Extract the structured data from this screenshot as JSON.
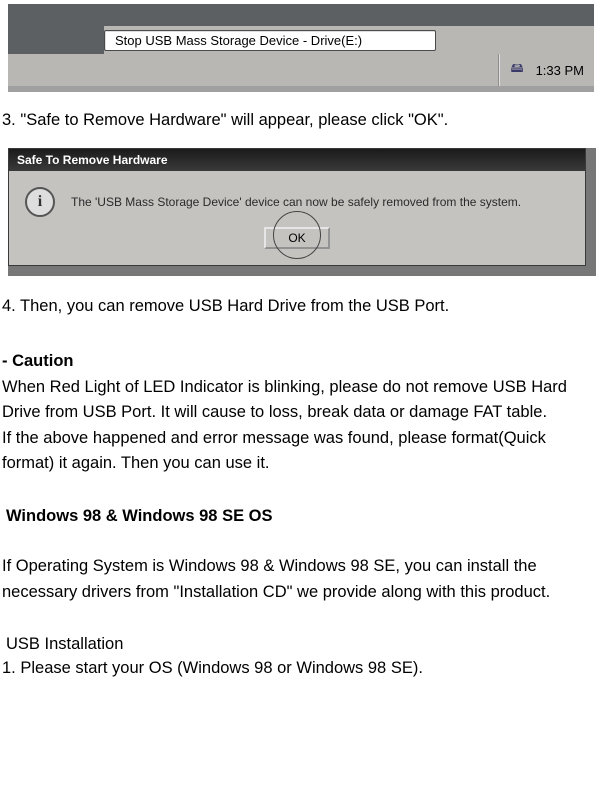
{
  "taskbar": {
    "stop_label": "Stop USB Mass Storage Device - Drive(E:)",
    "tray_time": "1:33 PM",
    "tray_icon_glyph": "🖴"
  },
  "step3": "3. \"Safe to Remove Hardware\" will appear, please click \"OK\".",
  "dialog": {
    "title": "Safe To Remove Hardware",
    "message": "The 'USB Mass Storage Device' device can now be safely removed from the system.",
    "ok_label": "OK",
    "info_glyph": "i"
  },
  "step4": "4. Then,  you can remove USB Hard Drive from the USB Port.",
  "caution_heading": "- Caution",
  "caution_p1": "When Red Light of LED Indicator is blinking, please do not remove USB Hard Drive from USB Port. It will cause to loss, break data or damage FAT table.",
  "caution_p2": "If the above happened and error message was found, please format(Quick format) it again. Then you can use it.",
  "w98_heading": "Windows 98 & Windows 98 SE OS",
  "w98_p": "If Operating System is  Windows 98 & Windows 98 SE, you can install the necessary drivers from \"Installation CD\" we provide along with this product.",
  "usb_install_heading": "USB Installation",
  "usb_step1": "1. Please start your OS (Windows 98 or Windows  98 SE)."
}
